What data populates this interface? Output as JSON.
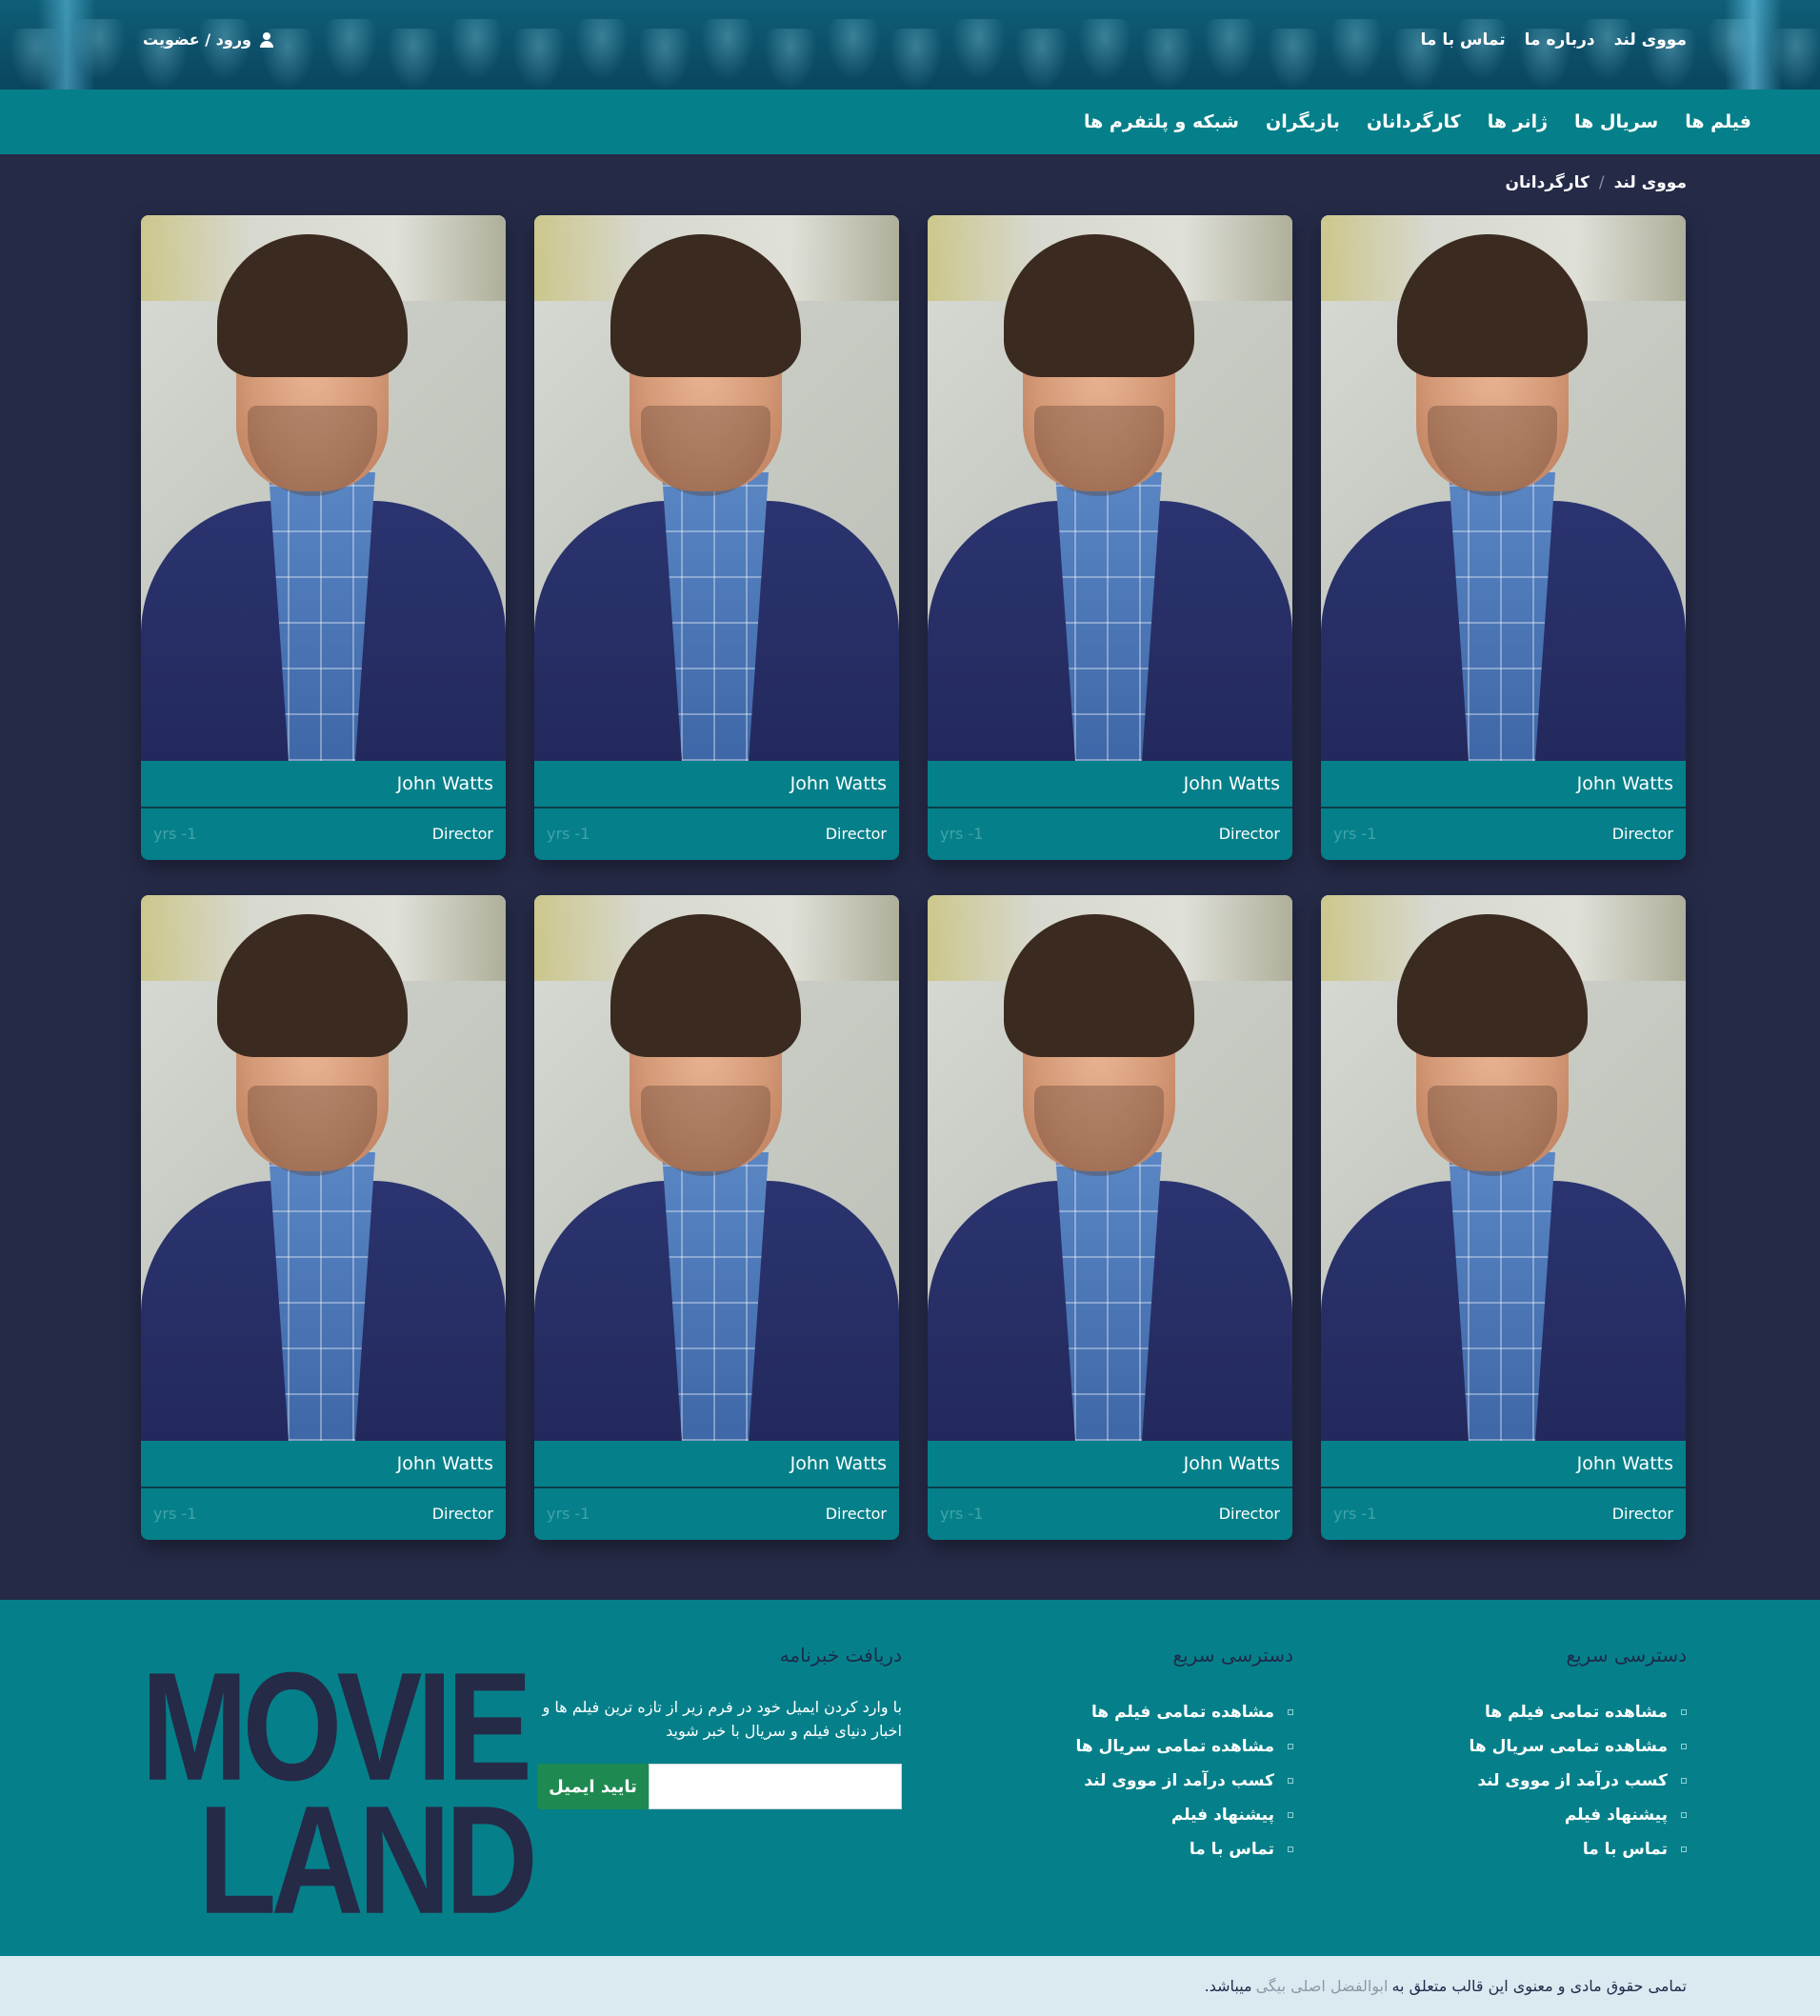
{
  "header": {
    "links": [
      "مووی لند",
      "درباره ما",
      "تماس با ما"
    ],
    "login_label": "ورود / عضویت"
  },
  "nav": {
    "items": [
      "فیلم ها",
      "سریال ها",
      "ژانر ها",
      "کارگردانان",
      "بازیگران",
      "شبکه و پلتفرم ها"
    ]
  },
  "breadcrumb": {
    "home": "مووی لند",
    "separator": "/",
    "current": "کارگردانان"
  },
  "cards": [
    {
      "name": "John Watts",
      "role": "Director",
      "age": "yrs -1"
    },
    {
      "name": "John Watts",
      "role": "Director",
      "age": "yrs -1"
    },
    {
      "name": "John Watts",
      "role": "Director",
      "age": "yrs -1"
    },
    {
      "name": "John Watts",
      "role": "Director",
      "age": "yrs -1"
    },
    {
      "name": "John Watts",
      "role": "Director",
      "age": "yrs -1"
    },
    {
      "name": "John Watts",
      "role": "Director",
      "age": "yrs -1"
    },
    {
      "name": "John Watts",
      "role": "Director",
      "age": "yrs -1"
    },
    {
      "name": "John Watts",
      "role": "Director",
      "age": "yrs -1"
    }
  ],
  "footer": {
    "quick_access_1": {
      "title": "دسترسی سریع",
      "items": [
        "مشاهده تمامی فیلم ها",
        "مشاهده تمامی سریال ها",
        "کسب درآمد از مووی لند",
        "پیشنهاد فیلم",
        "تماس با ما"
      ]
    },
    "quick_access_2": {
      "title": "دسترسی سریع",
      "items": [
        "مشاهده تمامی فیلم ها",
        "مشاهده تمامی سریال ها",
        "کسب درآمد از مووی لند",
        "پیشنهاد فیلم",
        "تماس با ما"
      ]
    },
    "newsletter": {
      "title": "دریافت خبرنامه",
      "description": "با وارد کردن ایمیل خود در فرم زیر از تازه ترین فیلم ها و اخبار دنیای فیلم و سریال با خبر شوید",
      "button_label": "تایید ایمیل",
      "input_value": ""
    },
    "logo": {
      "line1": "MOVIE",
      "line2": "LAND"
    }
  },
  "copyright": {
    "prefix": "تمامی حقوق مادی و معنوی این قالب متعلق به",
    "author": "ابوالفضل اصلی بیگی",
    "suffix": "میباشد."
  },
  "colors": {
    "page_bg": "#252a47",
    "accent_teal": "#05808a",
    "button_green": "#1e8a51",
    "copyright_bg": "#dbeaf1"
  }
}
